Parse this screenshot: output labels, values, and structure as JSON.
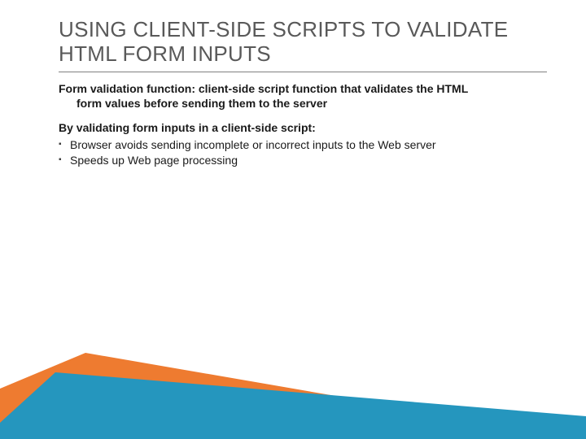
{
  "slide": {
    "title": "USING CLIENT-SIDE SCRIPTS TO VALIDATE HTML FORM INPUTS",
    "para1_line1": "Form validation function: client-side script function that validates the HTML",
    "para1_line2": "form values before sending them to the server",
    "para2_heading": "By validating form inputs in a client-side script:",
    "bullets": [
      "Browser avoids sending incomplete or incorrect inputs to the Web server",
      "Speeds up Web page processing"
    ]
  },
  "colors": {
    "orange": "#ee7b30",
    "teal": "#2596be"
  }
}
